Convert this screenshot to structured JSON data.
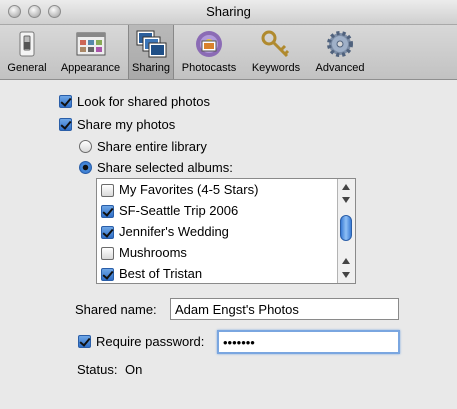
{
  "window": {
    "title": "Sharing"
  },
  "toolbar": {
    "items": [
      {
        "label": "General",
        "icon": "switch-icon"
      },
      {
        "label": "Appearance",
        "icon": "window-layout-icon"
      },
      {
        "label": "Sharing",
        "icon": "shared-photos-icon"
      },
      {
        "label": "Photocasts",
        "icon": "photocast-icon"
      },
      {
        "label": "Keywords",
        "icon": "key-icon"
      },
      {
        "label": "Advanced",
        "icon": "gear-icon"
      }
    ],
    "selected": "Sharing"
  },
  "options": {
    "look_for_shared": {
      "label": "Look for shared photos",
      "checked": true
    },
    "share_my_photos": {
      "label": "Share my photos",
      "checked": true
    },
    "share_entire": {
      "label": "Share entire library",
      "selected": false
    },
    "share_selected": {
      "label": "Share selected albums:",
      "selected": true
    }
  },
  "albums": [
    {
      "name": "My Favorites (4-5 Stars)",
      "checked": false
    },
    {
      "name": "SF-Seattle Trip 2006",
      "checked": true
    },
    {
      "name": "Jennifer's Wedding",
      "checked": true
    },
    {
      "name": "Mushrooms",
      "checked": false
    },
    {
      "name": "Best of Tristan",
      "checked": true
    }
  ],
  "shared_name": {
    "label": "Shared name:",
    "value": "Adam Engst's Photos"
  },
  "password": {
    "label": "Require password:",
    "checked": true,
    "value": "•••••••"
  },
  "status": {
    "label": "Status:",
    "value": "On"
  },
  "colors": {
    "accent": "#2f6fc8",
    "window_bg": "#e9e9e9"
  }
}
